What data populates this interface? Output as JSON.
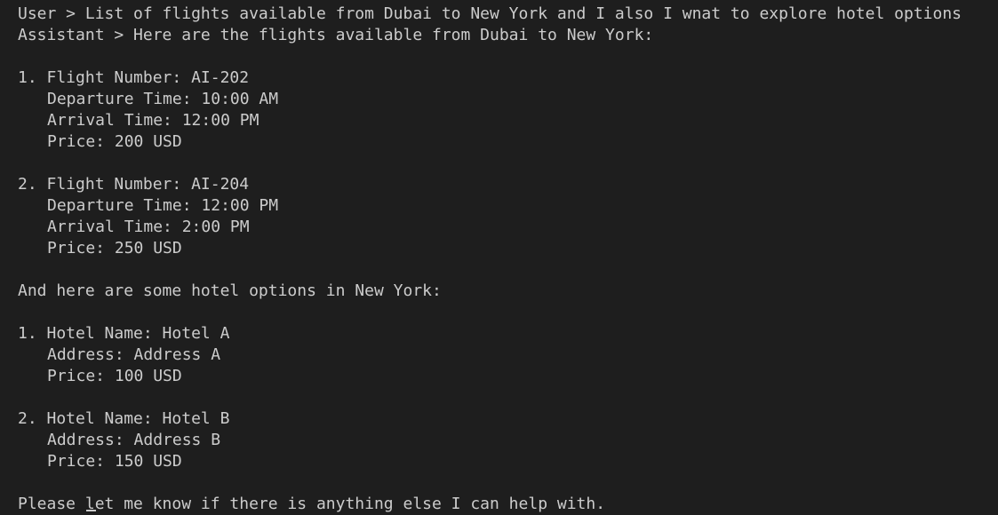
{
  "conversation": {
    "user_line": "User > List of flights available from Dubai to New York and I also I wnat to explore hotel options",
    "assistant_line": "Assistant > Here are the flights available from Dubai to New York:"
  },
  "flights": [
    {
      "number_line": "1. Flight Number: AI-202",
      "departure": "Departure Time: 10:00 AM",
      "arrival": "Arrival Time: 12:00 PM",
      "price": "Price: 200 USD"
    },
    {
      "number_line": "2. Flight Number: AI-204",
      "departure": "Departure Time: 12:00 PM",
      "arrival": "Arrival Time: 2:00 PM",
      "price": "Price: 250 USD"
    }
  ],
  "hotels_intro": "And here are some hotel options in New York:",
  "hotels": [
    {
      "name_line": "1. Hotel Name: Hotel A",
      "address": "Address: Address A",
      "price": "Price: 100 USD"
    },
    {
      "name_line": "2. Hotel Name: Hotel B",
      "address": "Address: Address B",
      "price": "Price: 150 USD"
    }
  ],
  "closing": "Please let me know if there is anything else I can help with.",
  "colors": {
    "background": "#1e1e1e",
    "text": "#cccccc"
  }
}
